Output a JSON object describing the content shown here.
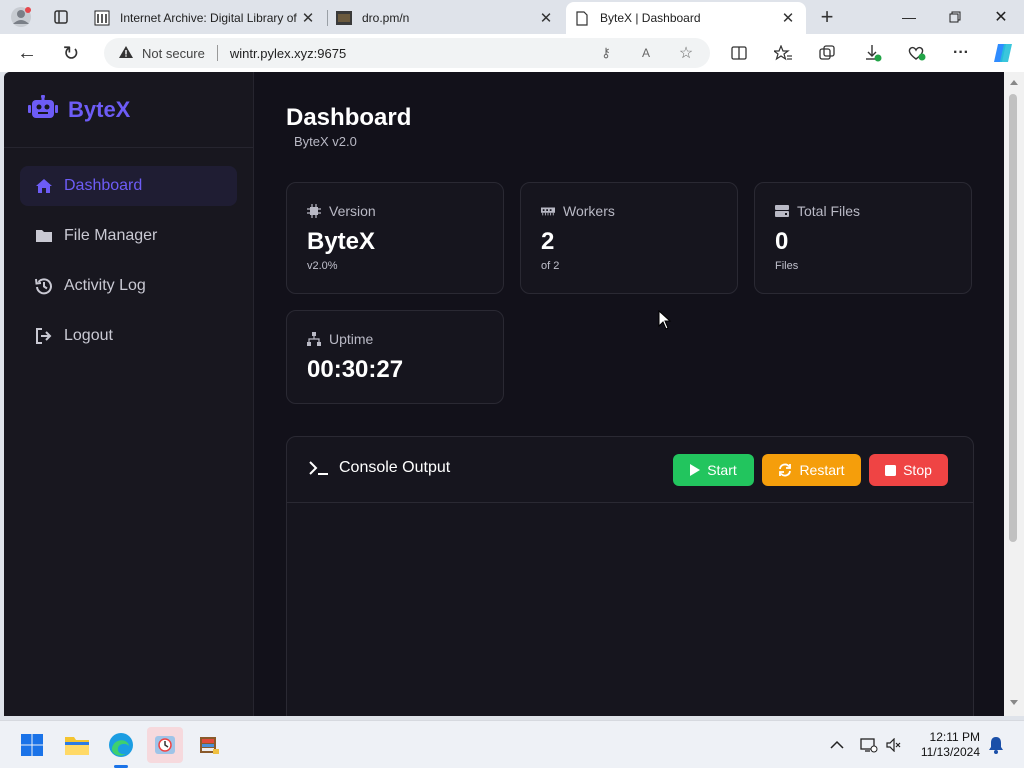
{
  "browser": {
    "tabs": [
      {
        "title": "Internet Archive: Digital Library of",
        "icon": "archive-icon"
      },
      {
        "title": "dro.pm/n",
        "icon": "image-icon"
      },
      {
        "title": "ByteX | Dashboard",
        "icon": "page-icon",
        "active": true
      }
    ],
    "address": {
      "security_label": "Not secure",
      "url": "wintr.pylex.xyz:9675"
    }
  },
  "sidebar": {
    "brand": "ByteX",
    "items": [
      {
        "label": "Dashboard",
        "icon": "home-icon",
        "active": true
      },
      {
        "label": "File Manager",
        "icon": "folder-icon"
      },
      {
        "label": "Activity Log",
        "icon": "history-icon"
      },
      {
        "label": "Logout",
        "icon": "logout-icon"
      }
    ]
  },
  "header": {
    "title": "Dashboard",
    "subtitle": "ByteX v2.0"
  },
  "stats": {
    "version": {
      "label": "Version",
      "value": "ByteX",
      "sub": "v2.0%"
    },
    "workers": {
      "label": "Workers",
      "value": "2",
      "sub": "of 2"
    },
    "files": {
      "label": "Total Files",
      "value": "0",
      "sub": "Files"
    },
    "uptime": {
      "label": "Uptime",
      "value": "00:30:27"
    }
  },
  "console": {
    "title": "Console Output",
    "start_label": "Start",
    "restart_label": "Restart",
    "stop_label": "Stop"
  },
  "taskbar": {
    "time": "12:11 PM",
    "date": "11/13/2024"
  },
  "colors": {
    "accent": "#6d5cf6",
    "start": "#22c55e",
    "restart": "#f59e0b",
    "stop": "#ef4444",
    "background": "#12111a"
  }
}
